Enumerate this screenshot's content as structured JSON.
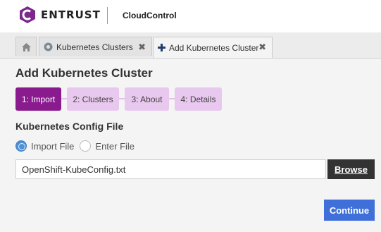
{
  "header": {
    "brand": "ENTRUST",
    "product": "CloudControl"
  },
  "tabs": [
    {
      "label": "",
      "icon": "home-icon"
    },
    {
      "label": "Kubernetes Clusters",
      "icon": "cluster-icon",
      "close": "✖"
    },
    {
      "label": "Add Kubernetes Cluster",
      "icon": "plus-icon",
      "close": "✖"
    }
  ],
  "page": {
    "title": "Add Kubernetes Cluster"
  },
  "steps": [
    {
      "label": "1: Import",
      "active": true
    },
    {
      "label": "2: Clusters",
      "active": false
    },
    {
      "label": "3: About",
      "active": false
    },
    {
      "label": "4: Details",
      "active": false
    }
  ],
  "config": {
    "section_title": "Kubernetes Config File",
    "radio_import": "Import File",
    "radio_enter": "Enter File",
    "selected": "Import File",
    "file_value": "OpenShift-KubeConfig.txt",
    "browse_label": "Browse"
  },
  "actions": {
    "continue_label": "Continue"
  },
  "colors": {
    "accent_purple": "#8a1b8f",
    "step_inactive": "#e8c8ee",
    "primary_blue": "#3f6fd8",
    "radio_blue": "#4d90d6"
  }
}
